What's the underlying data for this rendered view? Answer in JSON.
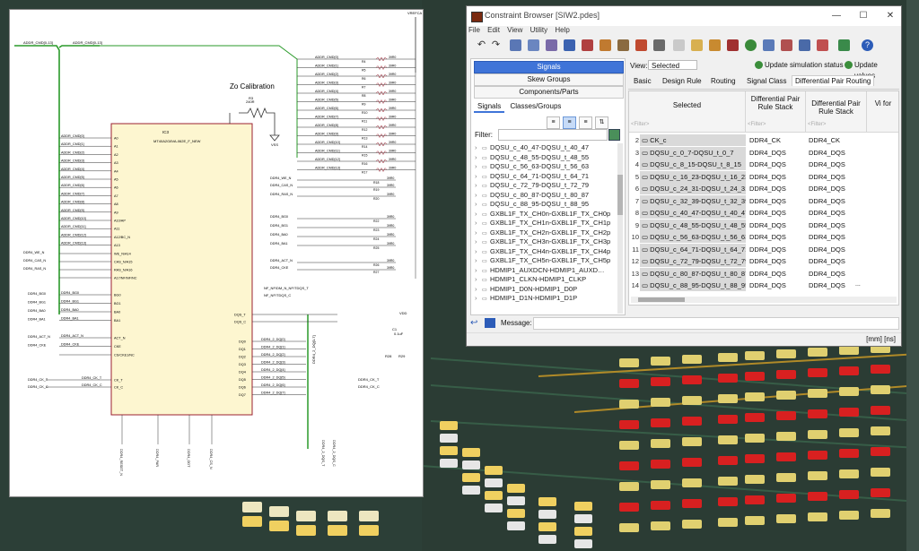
{
  "schematic": {
    "title": "Zo Calibration",
    "ic_ref": "IC3",
    "ic_part": "MT40A2G8VA-062E_F_NEW",
    "vrefca": "VREFCA",
    "vdd": "VDD",
    "vss": "VSS",
    "r3": "R3",
    "r3_value": "240R",
    "bus_label": "ADDR_CMD[0-13]",
    "bus_label2": "ADDR_CMD[0-13]",
    "right_nets": [
      "ADDR_CMD[0]",
      "ADDR_CMD[1]",
      "ADDR_CMD[2]",
      "ADDR_CMD[3]",
      "ADDR_CMD[4]",
      "ADDR_CMD[5]",
      "ADDR_CMD[6]",
      "ADDR_CMD[7]",
      "ADDR_CMD[8]",
      "ADDR_CMD[9]",
      "ADDR_CMD[10]",
      "ADDR_CMD[11]",
      "ADDR_CMD[12]",
      "ADDR_CMD[13]"
    ],
    "right_refs": [
      "R4",
      "R5",
      "R6",
      "R7",
      "R8",
      "R9",
      "R10",
      "R11",
      "R12",
      "R13",
      "R14",
      "R15",
      "R16",
      "R17"
    ],
    "ctrl_nets": [
      "DDR4_WE_N",
      "DDR4_CAS_N",
      "DDR4_RAS_N",
      "DDR4_BG0",
      "DDR4_BG1",
      "DDR4_BA0",
      "DDR4_BA1",
      "DDR4_ACT_N",
      "DDR4_CKE"
    ],
    "left_pins": [
      "A0",
      "A1",
      "A2",
      "A3",
      "A4",
      "A5",
      "A6",
      "A7",
      "A8",
      "A9",
      "A10/AP",
      "A11",
      "A12/BC_N",
      "A13"
    ],
    "left_ctrl_pins": [
      "WE_N/A14",
      "CAS_N/A15",
      "RAS_N/A16",
      "A17/NF/NF/NC"
    ],
    "bank_pins": [
      "BG0",
      "BG1",
      "BA0",
      "BA1"
    ],
    "act_pins": [
      "ACT_N",
      "CKE",
      "CS/CKE1/NC"
    ],
    "ck_pins": [
      "CK_T",
      "CK_C"
    ],
    "dq_pins": [
      "DQ0",
      "DQ1",
      "DQ2",
      "DQ3",
      "DQ4",
      "DQ5",
      "DQ6",
      "DQ7"
    ],
    "dq_nets": [
      "DDR4_2_DQ[0]",
      "DDR4_2_DQ[1]",
      "DDR4_2_DQ[2]",
      "DDR4_2_DQ[3]",
      "DDR4_2_DQ[4]",
      "DDR4_2_DQ[5]",
      "DDR4_2_DQ[6]",
      "DDR4_2_DQ[7]"
    ],
    "dqs_pins": [
      "DQS_T",
      "DQS_C"
    ],
    "ck_nets": [
      "DDR4_CK_T",
      "DDR4_CK_C"
    ],
    "bottom_nets": [
      "DDR4_RESET_N",
      "DDR4_PAR",
      "DDR4_ODT",
      "DDR4_CS_N"
    ],
    "dqs_nets": [
      "DDR4_2_DQS_T",
      "DDR4_2_DQS_C"
    ],
    "dq_bus": "DDR4_2_DQ[0-7]",
    "dm_pin": "NF_NF/DM_N_NF/TDQS_T",
    "tdqs_pin": "NF_NF/TDQS_C",
    "res_value": "39R0",
    "cap_ref": "C1",
    "cap_value": "0.1uF",
    "r28": "R28",
    "r29": "R29"
  },
  "window": {
    "title": "Constraint Browser [SIW2.pdes]",
    "minimize": "—",
    "maximize": "☐",
    "close": "✕"
  },
  "menu": [
    "File",
    "Edit",
    "View",
    "Utility",
    "Help"
  ],
  "nav": {
    "signals": "Signals",
    "skew_groups": "Skew Groups",
    "components": "Components/Parts"
  },
  "left_tabs": [
    "Signals",
    "Classes/Groups"
  ],
  "filter_label": "Filter:",
  "signals_list": [
    "DQSU_c_40_47-DQSU_t_40_47",
    "DQSU_c_48_55-DQSU_t_48_55",
    "DQSU_c_56_63-DQSU_t_56_63",
    "DQSU_c_64_71-DQSU_t_64_71",
    "DQSU_c_72_79-DQSU_t_72_79",
    "DQSU_c_80_87-DQSU_t_80_87",
    "DQSU_c_88_95-DQSU_t_88_95",
    "GXBL1F_TX_CH0n-GXBL1F_TX_CH0p",
    "GXBL1F_TX_CH1n-GXBL1F_TX_CH1p",
    "GXBL1F_TX_CH2n-GXBL1F_TX_CH2p",
    "GXBL1F_TX_CH3n-GXBL1F_TX_CH3p",
    "GXBL1F_TX_CH4n-GXBL1F_TX_CH4p",
    "GXBL1F_TX_CH5n-GXBL1F_TX_CH5p",
    "HDMIP1_AUXDCN-HDMIP1_AUXD…",
    "HDMIP1_CLKN-HDMIP1_CLKP",
    "HDMIP1_D0N-HDMIP1_D0P",
    "HDMIP1_D1N-HDMIP1_D1P"
  ],
  "view": {
    "label": "View:",
    "selected": "Selected",
    "update_sim": "Update simulation status",
    "update_vals": "Update values"
  },
  "tabs": [
    "Basic",
    "Design Rule",
    "Routing",
    "Signal Class",
    "Differential Pair Routing"
  ],
  "grid": {
    "headers": [
      "Selected",
      "Differential Pair Rule Stack",
      "Differential Pair Rule Stack",
      "Vi for"
    ],
    "filter_hint": "<Filter>",
    "rows": [
      {
        "n": "2",
        "name": "CK_c",
        "v1": "DDR4_CK",
        "v2": "DDR4_CK"
      },
      {
        "n": "3",
        "name": "DQSU_c_0_7-DQSU_t_0_7",
        "v1": "DDR4_DQS",
        "v2": "DDR4_DQS"
      },
      {
        "n": "4",
        "name": "DQSU_c_8_15-DQSU_t_8_15",
        "v1": "DDR4_DQS",
        "v2": "DDR4_DQS"
      },
      {
        "n": "5",
        "name": "DQSU_c_16_23-DQSU_t_16_23",
        "v1": "DDR4_DQS",
        "v2": "DDR4_DQS"
      },
      {
        "n": "6",
        "name": "DQSU_c_24_31-DQSU_t_24_31",
        "v1": "DDR4_DQS",
        "v2": "DDR4_DQS"
      },
      {
        "n": "7",
        "name": "DQSU_c_32_39-DQSU_t_32_39",
        "v1": "DDR4_DQS",
        "v2": "DDR4_DQS"
      },
      {
        "n": "8",
        "name": "DQSU_c_40_47-DQSU_t_40_47",
        "v1": "DDR4_DQS",
        "v2": "DDR4_DQS"
      },
      {
        "n": "9",
        "name": "DQSU_c_48_55-DQSU_t_48_55",
        "v1": "DDR4_DQS",
        "v2": "DDR4_DQS"
      },
      {
        "n": "10",
        "name": "DQSU_c_56_63-DQSU_t_56_63",
        "v1": "DDR4_DQS",
        "v2": "DDR4_DQS"
      },
      {
        "n": "11",
        "name": "DQSU_c_64_71-DQSU_t_64_71",
        "v1": "DDR4_DQS",
        "v2": "DDR4_DQS"
      },
      {
        "n": "12",
        "name": "DQSU_c_72_79-DQSU_t_72_79",
        "v1": "DDR4_DQS",
        "v2": "DDR4_DQS"
      },
      {
        "n": "13",
        "name": "DQSU_c_80_87-DQSU_t_80_87",
        "v1": "DDR4_DQS",
        "v2": "DDR4_DQS"
      },
      {
        "n": "14",
        "name": "DQSU_c_88_95-DQSU_t_88_95",
        "v1": "DDR4_DQS",
        "v2": "DDR4_DQS"
      }
    ],
    "ellipsis": "..."
  },
  "message_label": "Message:",
  "status": "[mm]  [ns]",
  "colors": {
    "accent": "#3f74d8",
    "pcb_green": "#1d6b3c",
    "pad_red": "#d82020",
    "pad_yellow": "#e0d070",
    "bus_green": "#2a9a2a"
  }
}
